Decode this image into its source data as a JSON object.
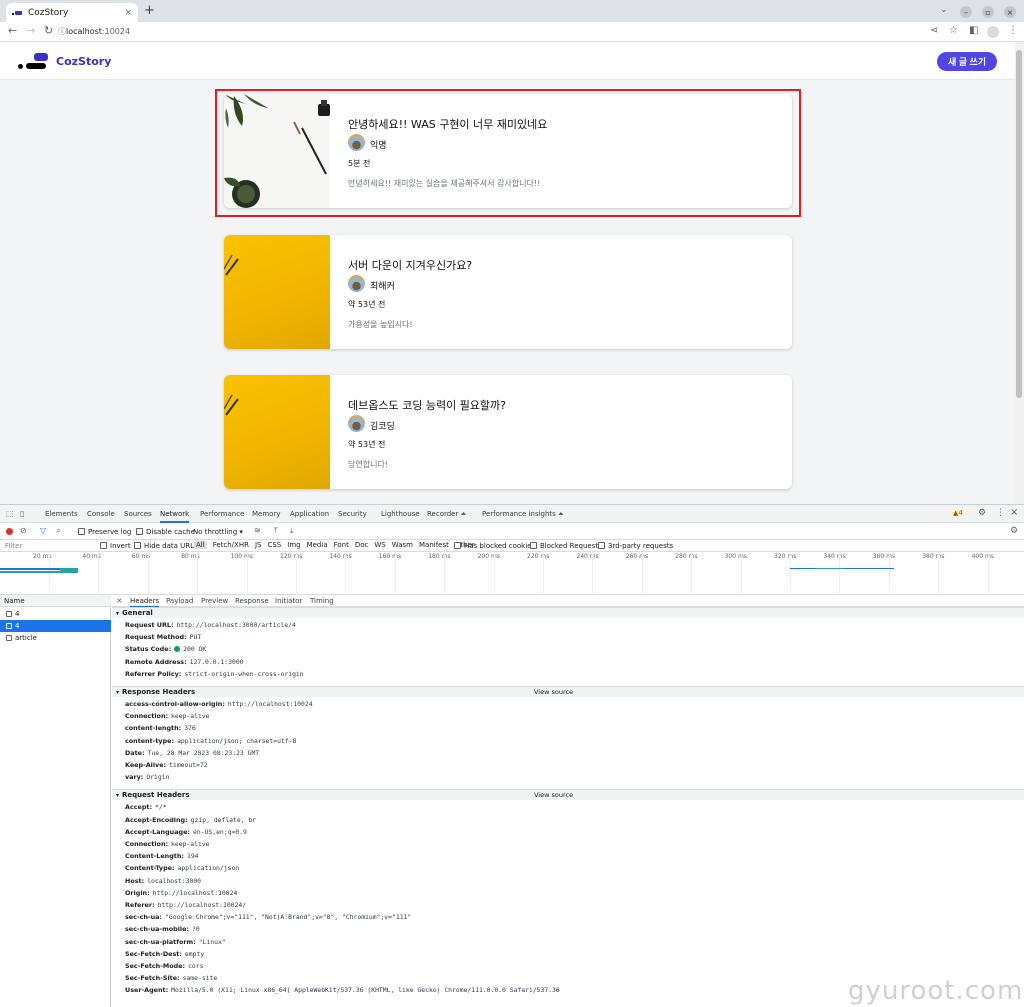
{
  "browser": {
    "tab_title": "CozStory",
    "tab_close": "×",
    "new_tab": "+",
    "url_host": "localhost",
    "url_port": ":10024",
    "window_minimize": "–",
    "window_restore": "▫",
    "window_close": "×"
  },
  "app": {
    "brand": "CozStory",
    "write_button": "새 글 쓰기"
  },
  "posts": [
    {
      "title": "안녕하세요!! WAS 구현이 너무 재미있네요",
      "author": "익명",
      "time": "5분 전",
      "body": "안녕하세요!! 재미있는 실습을 제공해주셔서 감사합니다!!",
      "thumb": "white-desk"
    },
    {
      "title": "서버 다운이 지겨우신가요?",
      "author": "최해커",
      "time": "약 53년 전",
      "body": "가용성을 높입시다!",
      "thumb": "yellow"
    },
    {
      "title": "데브옵스도 코딩 능력이 필요할까?",
      "author": "김코딩",
      "time": "약 53년 전",
      "body": "당연합니다!",
      "thumb": "yellow"
    }
  ],
  "devtools": {
    "tabs": [
      "Elements",
      "Console",
      "Sources",
      "Network",
      "Performance",
      "Memory",
      "Application",
      "Security",
      "Lighthouse",
      "Recorder ⏶",
      "Performance insights ⏶"
    ],
    "active_tab": "Network",
    "warning_badge": "▲4",
    "toolbar": {
      "preserve_log": "Preserve log",
      "disable_cache": "Disable cache",
      "throttling": "No throttling"
    },
    "filter": {
      "placeholder": "Filter",
      "invert": "Invert",
      "hide_data_urls": "Hide data URLs",
      "types": [
        "All",
        "Fetch/XHR",
        "JS",
        "CSS",
        "Img",
        "Media",
        "Font",
        "Doc",
        "WS",
        "Wasm",
        "Manifest",
        "Other"
      ],
      "has_blocked_cookies": "Has blocked cookies",
      "blocked_requests": "Blocked Requests",
      "third_party": "3rd-party requests"
    },
    "timeline_ticks": [
      "20 ms",
      "40 ms",
      "60 ms",
      "80 ms",
      "100 ms",
      "120 ms",
      "140 ms",
      "160 ms",
      "180 ms",
      "200 ms",
      "220 ms",
      "240 ms",
      "260 ms",
      "280 ms",
      "300 ms",
      "320 ms",
      "340 ms",
      "360 ms",
      "380 ms",
      "400 ms"
    ],
    "name_header": "Name",
    "requests": [
      {
        "name": "4",
        "selected": false
      },
      {
        "name": "4",
        "selected": true
      },
      {
        "name": "article",
        "selected": false
      }
    ],
    "detail_tabs": [
      "Headers",
      "Payload",
      "Preview",
      "Response",
      "Initiator",
      "Timing"
    ],
    "detail_close": "×",
    "view_source": "View source",
    "general_title": "General",
    "general": [
      {
        "k": "Request URL:",
        "v": "http://localhost:3000/article/4"
      },
      {
        "k": "Request Method:",
        "v": "PUT"
      },
      {
        "k": "Status Code:",
        "v": "200 OK"
      },
      {
        "k": "Remote Address:",
        "v": "127.0.0.1:3000"
      },
      {
        "k": "Referrer Policy:",
        "v": "strict-origin-when-cross-origin"
      }
    ],
    "response_title": "Response Headers",
    "response_headers": [
      {
        "k": "access-control-allow-origin:",
        "v": "http://localhost:10024"
      },
      {
        "k": "Connection:",
        "v": "keep-alive"
      },
      {
        "k": "content-length:",
        "v": "376"
      },
      {
        "k": "content-type:",
        "v": "application/json; charset=utf-8"
      },
      {
        "k": "Date:",
        "v": "Tue, 28 Mar 2023 08:23:23 GMT"
      },
      {
        "k": "Keep-Alive:",
        "v": "timeout=72"
      },
      {
        "k": "vary:",
        "v": "Origin"
      }
    ],
    "request_title": "Request Headers",
    "request_headers": [
      {
        "k": "Accept:",
        "v": "*/*"
      },
      {
        "k": "Accept-Encoding:",
        "v": "gzip, deflate, br"
      },
      {
        "k": "Accept-Language:",
        "v": "en-US,en;q=0.9"
      },
      {
        "k": "Connection:",
        "v": "keep-alive"
      },
      {
        "k": "Content-Length:",
        "v": "194"
      },
      {
        "k": "Content-Type:",
        "v": "application/json"
      },
      {
        "k": "Host:",
        "v": "localhost:3000"
      },
      {
        "k": "Origin:",
        "v": "http://localhost:10024"
      },
      {
        "k": "Referer:",
        "v": "http://localhost:10024/"
      },
      {
        "k": "sec-ch-ua:",
        "v": "\"Google Chrome\";v=\"111\", \"Not(A:Brand\";v=\"8\", \"Chromium\";v=\"111\""
      },
      {
        "k": "sec-ch-ua-mobile:",
        "v": "?0"
      },
      {
        "k": "sec-ch-ua-platform:",
        "v": "\"Linux\""
      },
      {
        "k": "Sec-Fetch-Dest:",
        "v": "empty"
      },
      {
        "k": "Sec-Fetch-Mode:",
        "v": "cors"
      },
      {
        "k": "Sec-Fetch-Site:",
        "v": "same-site"
      },
      {
        "k": "User-Agent:",
        "v": "Mozilla/5.0 (X11; Linux x86_64) AppleWebKit/537.36 (KHTML, like Gecko) Chrome/111.0.0.0 Safari/537.36"
      }
    ]
  },
  "watermark": "gyuroot.com",
  "colors": {
    "brand": "#3b31c9",
    "button": "#4f46e5",
    "highlight": "#e11d24",
    "selected": "#1a73e8"
  }
}
